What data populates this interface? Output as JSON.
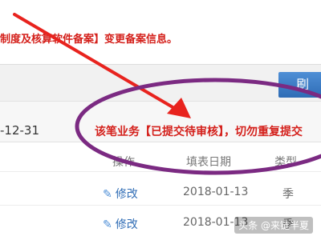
{
  "notice": {
    "text": "制度及核算软件备案】变更备案信息。"
  },
  "toolbar": {
    "refresh_label": "刷 新"
  },
  "record": {
    "date": "-12-31",
    "message": "该笔业务【已提交待审核】，切勿重复提交"
  },
  "table": {
    "headers": [
      "操作",
      "填表日期",
      "类型"
    ],
    "rows": [
      {
        "action": "修改",
        "date": "2018-01-13",
        "type": "季"
      },
      {
        "action": "修改",
        "date": "2018-01-13",
        "type": "季"
      }
    ]
  },
  "annotation": {
    "color": "#7b2a82",
    "arrow_color": "#e8231e"
  },
  "watermark": {
    "text": "头条 @来链半夏"
  },
  "icons": {
    "edit": "pencil-icon"
  }
}
